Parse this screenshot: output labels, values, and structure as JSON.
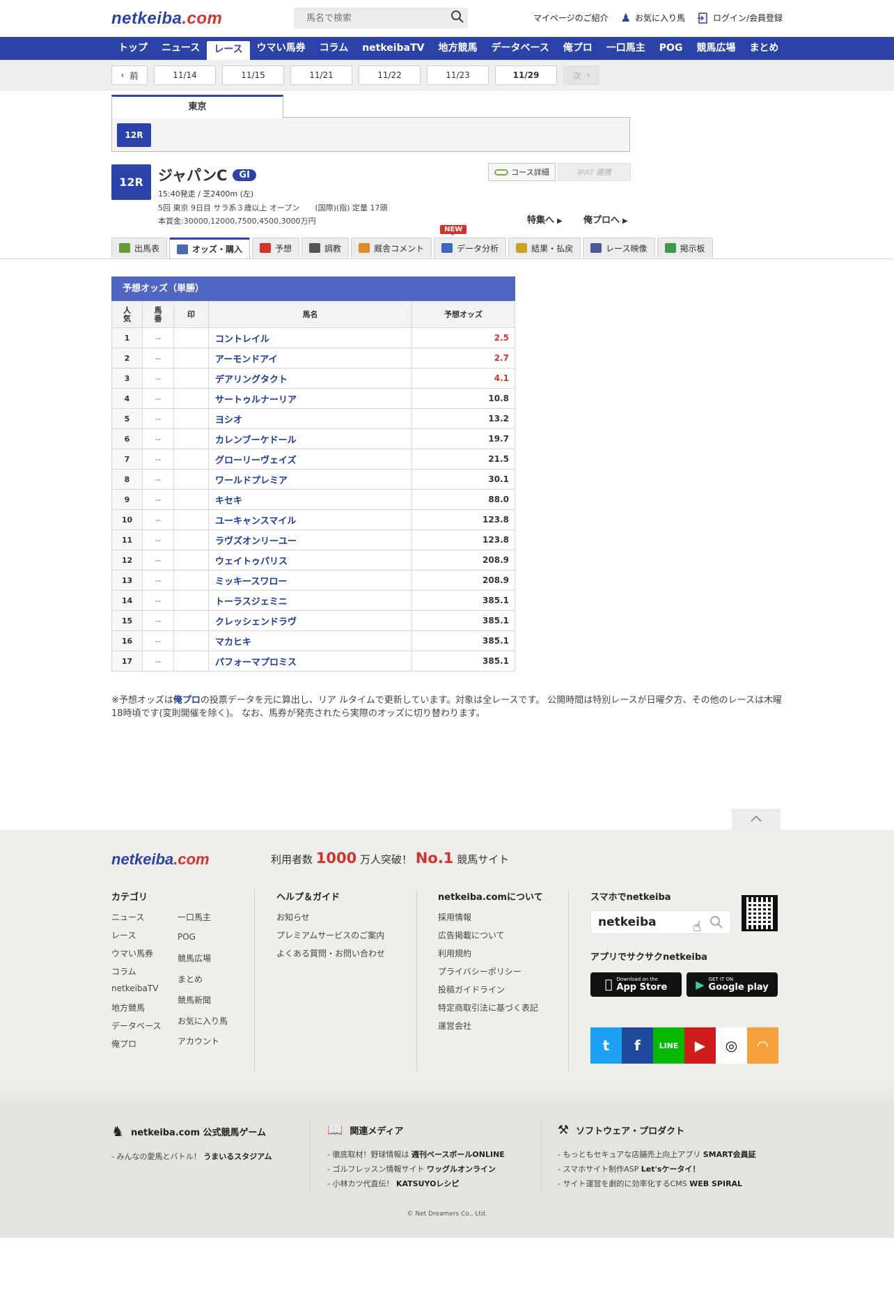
{
  "header": {
    "logo": "netkeiba",
    "logo_suffix": ".com",
    "search_placeholder": "馬名で検索",
    "links": [
      "マイページのご紹介",
      "お気に入り馬",
      "ログイン/会員登録"
    ]
  },
  "gnav": [
    "トップ",
    "ニュース",
    "レース",
    "ウマい馬券",
    "コラム",
    "netkeibaTV",
    "地方競馬",
    "データベース",
    "俺プロ",
    "一口馬主",
    "POG",
    "競馬広場",
    "まとめ"
  ],
  "gnav_current": "レース",
  "datebar": {
    "prev": "前",
    "next": "次",
    "dates": [
      "11/14",
      "11/15",
      "11/21",
      "11/22",
      "11/23",
      "11/29"
    ],
    "current": "11/29"
  },
  "venue": {
    "name": "東京",
    "race_button": "12R"
  },
  "race": {
    "num": "12R",
    "name": "ジャパンC",
    "grade": "GI",
    "data1": "15:40発走 / 芝2400m (左)",
    "data2": "5回 東京 9日目 サラ系３歳以上 オープン　　(国際)(指) 定量 17頭",
    "data3": "本賞金:30000,12000,7500,4500,3000万円",
    "course_btn": "コース詳細",
    "pat_btn": "IPAT 連携",
    "feature_link": "特集へ",
    "orepro_link": "俺プロへ"
  },
  "race_tabs": [
    {
      "label": "出馬表",
      "color": "#6a9a3a"
    },
    {
      "label": "オッズ・購入",
      "color": "#4a6ab0"
    },
    {
      "label": "予想",
      "color": "#d2332b"
    },
    {
      "label": "調教",
      "color": "#555555"
    },
    {
      "label": "厩舎コメント",
      "color": "#e08a2a"
    },
    {
      "label": "データ分析",
      "color": "#3a6ac0"
    },
    {
      "label": "結果・払戻",
      "color": "#c9a227"
    },
    {
      "label": "レース映像",
      "color": "#4a5a9a"
    },
    {
      "label": "掲示板",
      "color": "#3a9a4a"
    }
  ],
  "new_badge": "NEW",
  "odds": {
    "caption": "予想オッズ（単勝）",
    "headers": {
      "popular": "人気",
      "umaban": "馬番",
      "mark": "印",
      "name": "馬名",
      "odds": "予想オッズ"
    },
    "rows": [
      {
        "pop": "1",
        "umaban": "--",
        "name": "コントレイル",
        "odds": "2.5",
        "hot": true
      },
      {
        "pop": "2",
        "umaban": "--",
        "name": "アーモンドアイ",
        "odds": "2.7",
        "hot": true
      },
      {
        "pop": "3",
        "umaban": "--",
        "name": "デアリングタクト",
        "odds": "4.1",
        "hot": true
      },
      {
        "pop": "4",
        "umaban": "--",
        "name": "サートゥルナーリア",
        "odds": "10.8",
        "hot": false
      },
      {
        "pop": "5",
        "umaban": "--",
        "name": "ヨシオ",
        "odds": "13.2",
        "hot": false
      },
      {
        "pop": "6",
        "umaban": "--",
        "name": "カレンブーケドール",
        "odds": "19.7",
        "hot": false
      },
      {
        "pop": "7",
        "umaban": "--",
        "name": "グローリーヴェイズ",
        "odds": "21.5",
        "hot": false
      },
      {
        "pop": "8",
        "umaban": "--",
        "name": "ワールドプレミア",
        "odds": "30.1",
        "hot": false
      },
      {
        "pop": "9",
        "umaban": "--",
        "name": "キセキ",
        "odds": "88.0",
        "hot": false
      },
      {
        "pop": "10",
        "umaban": "--",
        "name": "ユーキャンスマイル",
        "odds": "123.8",
        "hot": false
      },
      {
        "pop": "11",
        "umaban": "--",
        "name": "ラヴズオンリーユー",
        "odds": "123.8",
        "hot": false
      },
      {
        "pop": "12",
        "umaban": "--",
        "name": "ウェイトゥパリス",
        "odds": "208.9",
        "hot": false
      },
      {
        "pop": "13",
        "umaban": "--",
        "name": "ミッキースワロー",
        "odds": "208.9",
        "hot": false
      },
      {
        "pop": "14",
        "umaban": "--",
        "name": "トーラスジェミニ",
        "odds": "385.1",
        "hot": false
      },
      {
        "pop": "15",
        "umaban": "--",
        "name": "クレッシェンドラヴ",
        "odds": "385.1",
        "hot": false
      },
      {
        "pop": "16",
        "umaban": "--",
        "name": "マカヒキ",
        "odds": "385.1",
        "hot": false
      },
      {
        "pop": "17",
        "umaban": "--",
        "name": "パフォーマプロミス",
        "odds": "385.1",
        "hot": false
      }
    ]
  },
  "note": {
    "pre": "※予想オッズは",
    "link": "俺プロ",
    "post": "の投票データを元に算出し、リア ルタイムで更新しています。対象は全レースです。 公開時間は特別レースが日曜夕方、その他のレースは木曜18時頃です(変則開催を除く)。 なお、馬券が発売されたら実際のオッズに切り替わります。"
  },
  "footer": {
    "logo": "netkeiba",
    "logo_suffix": ".com",
    "tag_pre": "利用者数",
    "tag_num": "1000",
    "tag_mid": "万人突破！",
    "tag_no1": "No.1",
    "tag_post": "競馬サイト",
    "category_title": "カテゴリ",
    "category_col1": [
      "ニュース",
      "レース",
      "ウマい馬券",
      "コラム",
      "netkeibaTV",
      "地方競馬",
      "データベース",
      "俺プロ"
    ],
    "category_col2": [
      "一口馬主",
      "POG",
      "競馬広場",
      "まとめ",
      "競馬新聞",
      "お気に入り馬",
      "アカウント"
    ],
    "help_title": "ヘルプ＆ガイド",
    "help": [
      "お知らせ",
      "プレミアムサービスのご案内",
      "よくある質問・お問い合わせ"
    ],
    "about_title": "netkeiba.comについて",
    "about": [
      "採用情報",
      "広告掲載について",
      "利用規約",
      "プライバシーポリシー",
      "投稿ガイドライン",
      "特定商取引法に基づく表記",
      "運営会社"
    ],
    "phone_title": "スマホでnetkeiba",
    "phone_search": "netkeiba",
    "app_title": "アプリでサクサクnetkeiba",
    "appstore_small": "Download on the",
    "appstore": "App Store",
    "gplay_small": "GET IT ON",
    "gplay": "Google play",
    "social": [
      {
        "name": "twitter-icon",
        "glyph": "t",
        "color": "#1da1f2"
      },
      {
        "name": "facebook-icon",
        "glyph": "f",
        "color": "#1e4a9b"
      },
      {
        "name": "line-icon",
        "glyph": "LINE",
        "color": "#00b900"
      },
      {
        "name": "youtube-icon",
        "glyph": "▶",
        "color": "#d01b1b"
      },
      {
        "name": "instagram-icon",
        "glyph": "◎",
        "color": "#ffffff"
      },
      {
        "name": "rss-icon",
        "glyph": "◠",
        "color": "#f7a13c"
      }
    ]
  },
  "band": {
    "game_title": "netkeiba.com 公式競馬ゲーム",
    "game_item_pre": "みんなの愛馬とバトル！",
    "game_item_bold": "うまいるスタジアム",
    "media_title": "関連メディア",
    "media": [
      {
        "pre": "徹底取材！野球情報は",
        "bold": "週刊ベースボールONLINE"
      },
      {
        "pre": "ゴルフレッスン情報サイト",
        "bold": "ワッグルオンライン"
      },
      {
        "pre": "小林カツ代直伝！",
        "bold": "KATSUYOレシピ"
      }
    ],
    "soft_title": "ソフトウェア・プロダクト",
    "soft": [
      {
        "pre": "もっともセキュアな店舗売上向上アプリ",
        "bold": "SMART会員証"
      },
      {
        "pre": "スマホサイト制作ASP",
        "bold": "Let'sケータイ！"
      },
      {
        "pre": "サイト運営を劇的に効率化するCMS",
        "bold": "WEB SPIRAL"
      }
    ],
    "copyright": "© Net Dreamers Co., Ltd."
  }
}
